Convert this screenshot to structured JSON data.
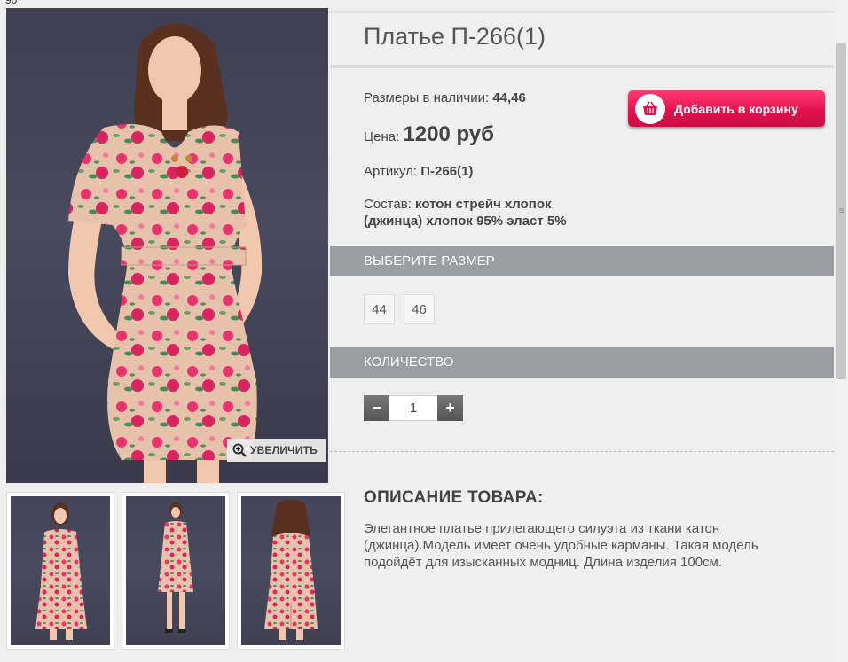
{
  "corner_text": "90",
  "product": {
    "title": "Платье П-266(1)",
    "sizes_label": "Размеры в наличии:",
    "sizes_value": "44,46",
    "price_label": "Цена:",
    "price_value": "1200 руб",
    "article_label": "Артикул:",
    "article_value": "П-266(1)",
    "composition_label": "Состав:",
    "composition_value_1": "котон стрейч хлопок",
    "composition_value_2": "(джинца) хлопок 95% эласт 5%"
  },
  "cart_button": {
    "label": "Добавить в корзину",
    "icon": "basket-icon"
  },
  "zoom_button": {
    "label": "УВЕЛИЧИТЬ",
    "icon": "magnifier-plus-icon"
  },
  "size_section": {
    "title": "ВЫБЕРИТЕ РАЗМЕР",
    "options": [
      "44",
      "46"
    ]
  },
  "quantity_section": {
    "title": "КОЛИЧЕСТВО",
    "value": "1",
    "minus": "−",
    "plus": "+"
  },
  "description": {
    "title": "ОПИСАНИЕ ТОВАРА:",
    "text": "Элегантное платье прилегающего силуэта из ткани катон (джинца).Модель имеет очень удобные карманы. Такая модель подойдёт для изысканных модниц. Длина изделия  100см."
  },
  "colors": {
    "accent": "#e4124e",
    "band": "#9a9da1",
    "dress": "#e9c3ad",
    "flower": "#e8336f"
  }
}
